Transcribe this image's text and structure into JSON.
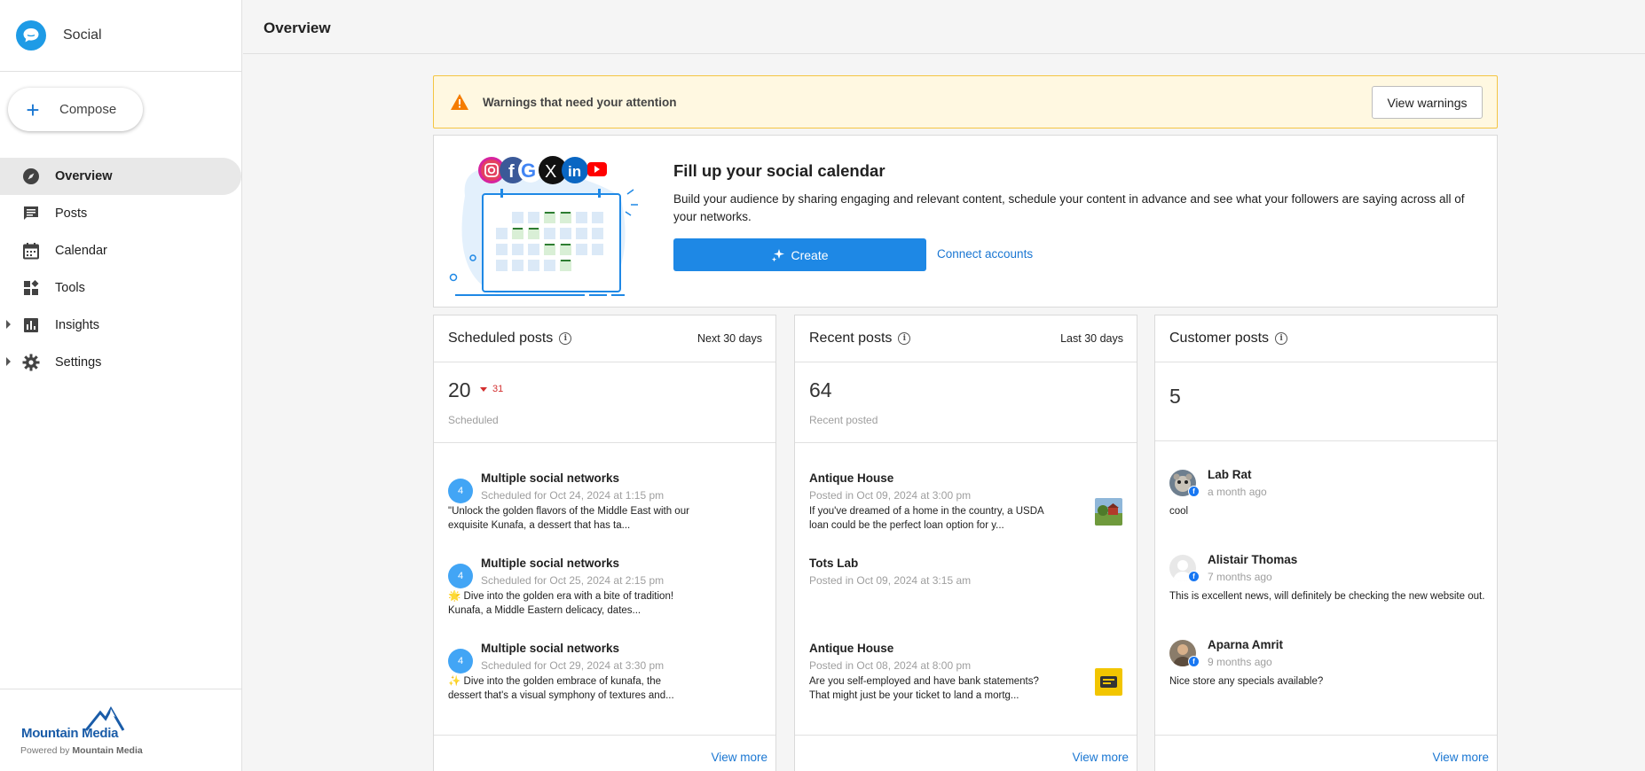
{
  "app": {
    "name": "Social"
  },
  "compose": {
    "label": "Compose"
  },
  "nav": [
    {
      "label": "Overview",
      "icon": "compass-icon",
      "active": true
    },
    {
      "label": "Posts",
      "icon": "chat-icon"
    },
    {
      "label": "Calendar",
      "icon": "calendar-icon"
    },
    {
      "label": "Tools",
      "icon": "widgets-icon"
    },
    {
      "label": "Insights",
      "icon": "bar-chart-icon",
      "expandable": true
    },
    {
      "label": "Settings",
      "icon": "gear-icon",
      "expandable": true
    }
  ],
  "footer": {
    "brand": "Mountain Media",
    "powered_prefix": "Powered by",
    "powered_brand": "Mountain Media"
  },
  "header": {
    "title": "Overview"
  },
  "warning": {
    "text": "Warnings that need your attention",
    "button": "View warnings",
    "color": "#fff8e1"
  },
  "promo": {
    "title": "Fill up your social calendar",
    "description": "Build your audience by sharing engaging and relevant content, schedule your content in advance and see what your followers are saying across all of your networks.",
    "create_label": "Create",
    "connect_label": "Connect accounts",
    "networks": [
      "instagram-icon",
      "facebook-icon",
      "google-icon",
      "x-icon",
      "linkedin-icon",
      "youtube-icon"
    ]
  },
  "scheduled": {
    "title": "Scheduled posts",
    "range": "Next 30 days",
    "count": "20",
    "delta": "31",
    "count_label": "Scheduled",
    "posts": [
      {
        "badge": "4",
        "title": "Multiple social networks",
        "sub": "Scheduled for Oct 24, 2024 at 1:15 pm",
        "body": "\"Unlock the golden flavors of the Middle East with our exquisite Kunafa, a dessert that has ta..."
      },
      {
        "badge": "4",
        "title": "Multiple social networks",
        "sub": "Scheduled for Oct 25, 2024 at 2:15 pm",
        "body": "🌟 Dive into the golden era with a bite of tradition! Kunafa, a Middle Eastern delicacy, dates..."
      },
      {
        "badge": "4",
        "title": "Multiple social networks",
        "sub": "Scheduled for Oct 29, 2024 at 3:30 pm",
        "body": "✨ Dive into the golden embrace of kunafa, the dessert that's a visual symphony of textures and..."
      }
    ],
    "view_more": "View more"
  },
  "recent": {
    "title": "Recent posts",
    "range": "Last 30 days",
    "count": "64",
    "count_label": "Recent posted",
    "posts": [
      {
        "title": "Antique House",
        "sub": "Posted in Oct 09, 2024 at 3:00 pm",
        "body": "If you've dreamed of a home in the country, a USDA loan could be the perfect loan option for y...",
        "thumb": "farmhouse-thumbnail"
      },
      {
        "title": "Tots Lab",
        "sub": "Posted in Oct 09, 2024 at 3:15 am",
        "body": ""
      },
      {
        "title": "Antique House",
        "sub": "Posted in Oct 08, 2024 at 8:00 pm",
        "body": "Are you self-employed and have bank statements? That might just be your ticket to land a mortg...",
        "thumb": "statement-thumbnail"
      }
    ],
    "view_more": "View more"
  },
  "customer": {
    "title": "Customer posts",
    "count": "5",
    "posts": [
      {
        "name": "Lab Rat",
        "time": "a month ago",
        "text": "cool"
      },
      {
        "name": "Alistair Thomas",
        "time": "7 months ago",
        "text": "This is excellent news, will definitely be checking the new website out."
      },
      {
        "name": "Aparna Amrit",
        "time": "9 months ago",
        "text": "Nice store any specials available?"
      }
    ],
    "view_more": "View more"
  },
  "colors": {
    "accent": "#1e88e5",
    "link": "#1976d2",
    "badge": "#42a5f5",
    "delta": "#d32f2f"
  }
}
